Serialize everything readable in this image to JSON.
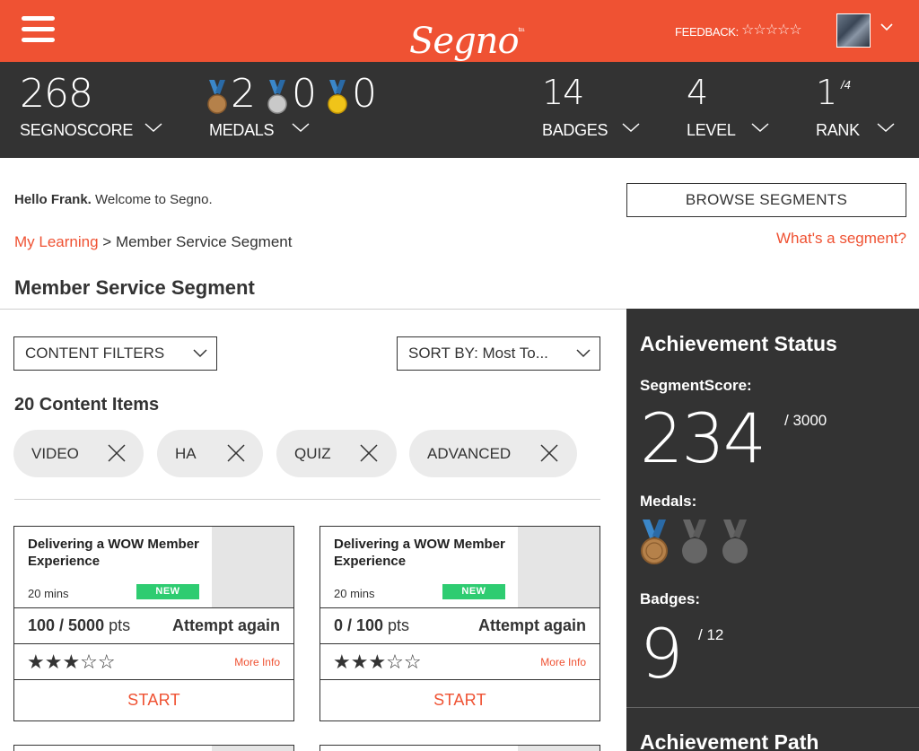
{
  "header": {
    "logo_text": "Segno",
    "logo_tm": "tm",
    "feedback_label": "FEEDBACK:",
    "feedback_stars": "☆☆☆☆☆",
    "colors": {
      "brand": "#ef5233",
      "dark": "#333333",
      "new_badge": "#2ecc71"
    }
  },
  "stats": {
    "segnoscore": {
      "value": "268",
      "label": "SEGNOSCORE"
    },
    "medals": {
      "bronze": "2",
      "silver": "0",
      "gold": "0",
      "label": "MEDALS"
    },
    "badges": {
      "value": "14",
      "label": "BADGES"
    },
    "level": {
      "value": "4",
      "label": "LEVEL"
    },
    "rank": {
      "value": "1",
      "of": "/4",
      "label": "RANK"
    }
  },
  "welcome": {
    "name": "Hello Frank.",
    "message": " Welcome to Segno."
  },
  "browse_button": "BROWSE SEGMENTS",
  "whats_segment": "What's a segment?",
  "breadcrumb": {
    "link": "My Learning",
    "separator": " > ",
    "current": "Member Service Segment"
  },
  "page_title": "Member Service Segment",
  "filters": {
    "content_filters": "CONTENT FILTERS",
    "sort_by": "SORT BY: Most To...",
    "count_text": "20 Content Items",
    "chips": [
      "VIDEO",
      "HA",
      "QUIZ",
      "ADVANCED"
    ]
  },
  "cards": [
    {
      "title": "Delivering a WOW Member Experience",
      "duration": "20 mins",
      "badge": "NEW",
      "points_earned": "100 / 5000",
      "points_unit": " pts",
      "action": "Attempt again",
      "stars": "★★★☆☆",
      "rating": 3,
      "more_info": "More Info",
      "start": "START"
    },
    {
      "title": "Delivering a WOW Member Experience",
      "duration": "20 mins",
      "badge": "NEW",
      "points_earned": "0 / 100",
      "points_unit": " pts",
      "action": "Attempt again",
      "stars": "★★★☆☆",
      "rating": 3,
      "more_info": "More Info",
      "start": "START"
    }
  ],
  "sidebar": {
    "title": "Achievement Status",
    "segment_score_label": "SegmentScore:",
    "segment_score": "234",
    "segment_score_max": "/ 3000",
    "medals_label": "Medals:",
    "badges_label": "Badges:",
    "badges_value": "9",
    "badges_max": "/ 12",
    "path_title": "Achievement Path"
  }
}
